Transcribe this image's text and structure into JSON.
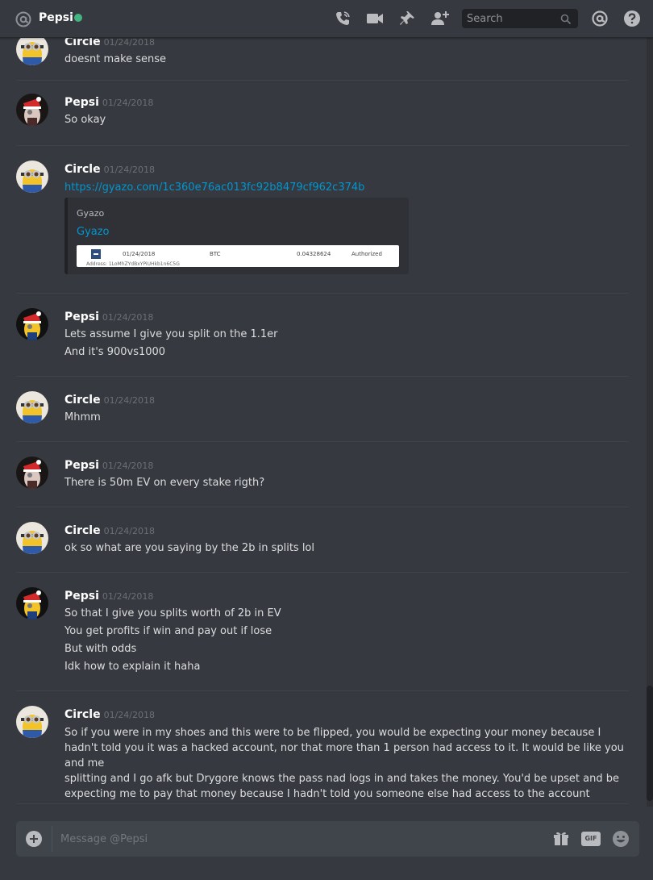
{
  "header": {
    "channel_name": "Pepsi",
    "status_color": "#43b581",
    "icons": [
      "at-icon",
      "call-icon",
      "video-icon",
      "pin-icon",
      "add-friend-icon",
      "mention-icon",
      "help-icon"
    ],
    "search_placeholder": "Search"
  },
  "messages": [
    {
      "author": "Circle",
      "timestamp": "01/24/2018",
      "avatar": "minion",
      "lines": [
        "doesnt make sense"
      ]
    },
    {
      "author": "Pepsi",
      "timestamp": "01/24/2018",
      "avatar": "minion-santa",
      "lines": [
        "So okay"
      ]
    },
    {
      "author": "Circle",
      "timestamp": "01/24/2018",
      "avatar": "minion",
      "link": "https://gyazo.com/1c360e76ac013fc92b8479cf962c374b",
      "embed": {
        "provider": "Gyazo",
        "title": "Gyazo",
        "image_row": {
          "date": "01/24/2018",
          "currency": "BTC",
          "amount": "0.04328624",
          "status": "Authorized",
          "address": "Address: 1LoMhZYdBxYPiUHkb1n6C5G"
        }
      }
    },
    {
      "author": "Pepsi",
      "timestamp": "01/24/2018",
      "avatar": "minion-santa",
      "lines": [
        "Lets assume I give you split on the 1.1er",
        "And it's 900vs1000"
      ]
    },
    {
      "author": "Circle",
      "timestamp": "01/24/2018",
      "avatar": "minion",
      "lines": [
        "Mhmm"
      ]
    },
    {
      "author": "Pepsi",
      "timestamp": "01/24/2018",
      "avatar": "minion-santa",
      "lines": [
        "There is 50m EV on every stake rigth?"
      ]
    },
    {
      "author": "Circle",
      "timestamp": "01/24/2018",
      "avatar": "minion",
      "lines": [
        "ok so what are you saying by the 2b in splits lol"
      ]
    },
    {
      "author": "Pepsi",
      "timestamp": "01/24/2018",
      "avatar": "minion-santa",
      "lines": [
        "So that I give you splits worth of 2b in EV",
        "You get profits if win and pay out if lose",
        "But with odds",
        "Idk how to explain it haha"
      ]
    },
    {
      "author": "Circle",
      "timestamp": "01/24/2018",
      "avatar": "minion",
      "paragraph_lines": [
        "So if you were in my shoes and this were to be flipped, you would be expecting your money because I",
        "hadn't told you it was a hacked account, nor that more than 1 person had access to it. It would be like you and me",
        "splitting and I go afk but Drygore knows the pass nad logs in and takes the money. You'd be upset and be",
        "expecting me to pay that money because I hadn't told you someone else had access to the account"
      ]
    }
  ],
  "composer": {
    "placeholder": "Message @Pepsi",
    "gif_label": "GIF",
    "icons": [
      "add-attachment-icon",
      "gift-icon",
      "gif-icon",
      "emoji-icon"
    ]
  }
}
